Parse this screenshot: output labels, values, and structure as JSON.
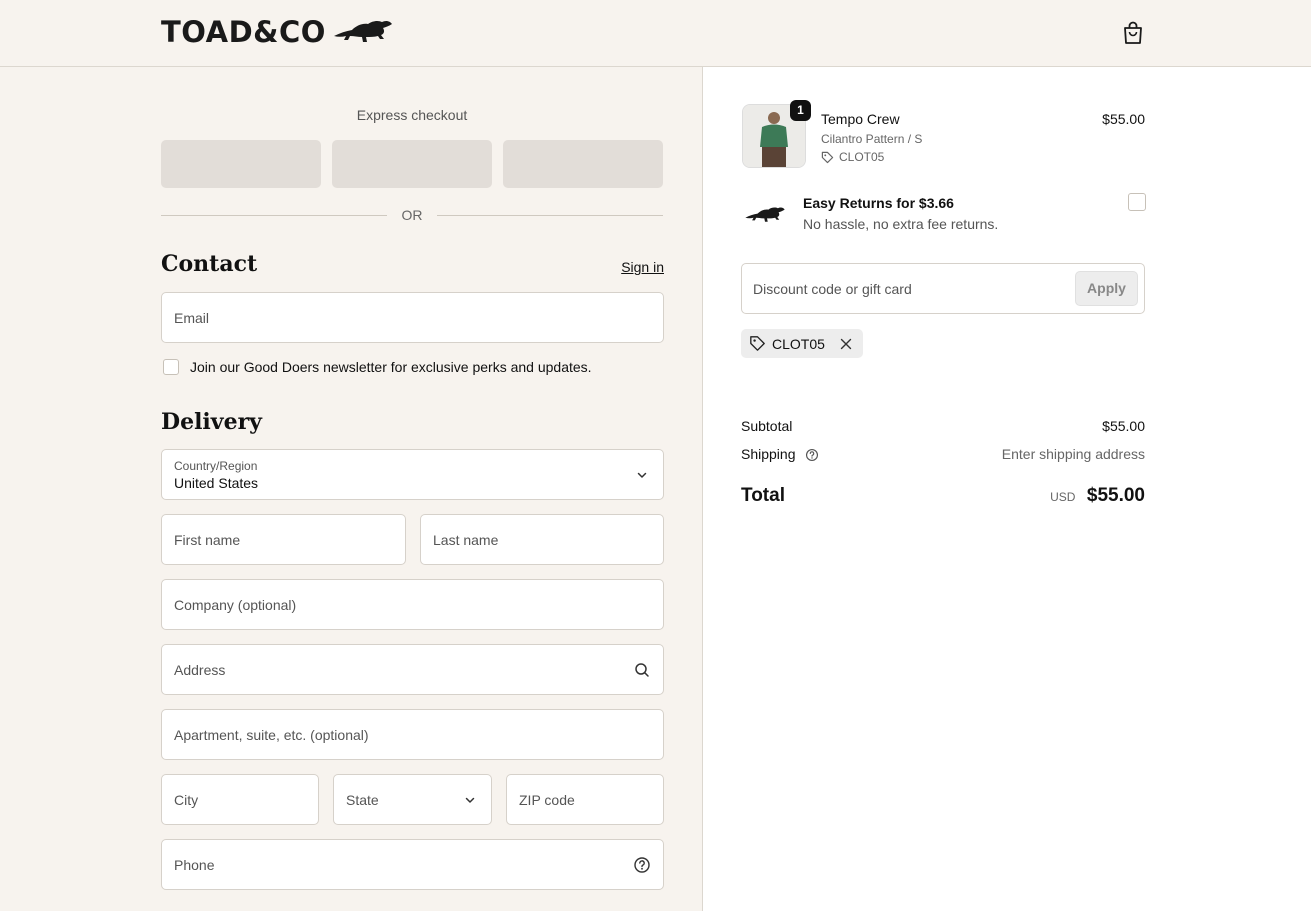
{
  "header": {
    "brand": "TOAD&CO",
    "cart_icon": "shopping-bag-icon"
  },
  "express": {
    "title": "Express checkout",
    "or_label": "OR"
  },
  "contact": {
    "heading": "Contact",
    "sign_in": "Sign in",
    "email_placeholder": "Email",
    "newsletter_label": "Join our Good Doers newsletter for exclusive perks and updates."
  },
  "delivery": {
    "heading": "Delivery",
    "country_label": "Country/Region",
    "country_value": "United States",
    "first_name": "First name",
    "last_name": "Last name",
    "company": "Company (optional)",
    "address": "Address",
    "apartment": "Apartment, suite, etc. (optional)",
    "city": "City",
    "state": "State",
    "zip": "ZIP code",
    "phone": "Phone"
  },
  "order": {
    "item": {
      "name": "Tempo Crew",
      "variant": "Cilantro Pattern / S",
      "code": "CLOT05",
      "price": "$55.00",
      "quantity": "1"
    },
    "returns": {
      "title": "Easy Returns for $3.66",
      "subtitle": "No hassle, no extra fee returns."
    },
    "discount": {
      "placeholder": "Discount code or gift card",
      "apply": "Apply",
      "applied_code": "CLOT05"
    },
    "summary": {
      "subtotal_label": "Subtotal",
      "subtotal_value": "$55.00",
      "shipping_label": "Shipping",
      "shipping_value": "Enter shipping address",
      "total_label": "Total",
      "currency": "USD",
      "total_value": "$55.00"
    }
  }
}
